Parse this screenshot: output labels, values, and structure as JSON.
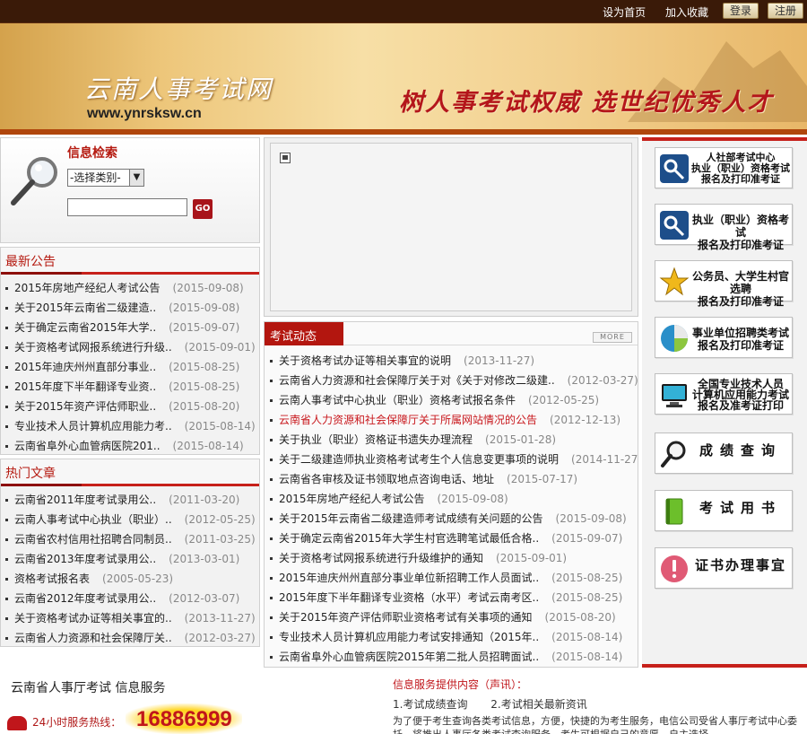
{
  "topbar": {
    "links": [
      "设为首页",
      "加入收藏"
    ],
    "login": "登录",
    "register": "注册"
  },
  "banner": {
    "site_name": "云南人事考试网",
    "site_url": "www.ynrsksw.cn",
    "slogan": "树人事考试权威  选世纪优秀人才"
  },
  "search": {
    "title": "信息检索",
    "category_selected": "-选择类别-",
    "go_label": "GO"
  },
  "announcements": {
    "title": "最新公告",
    "items": [
      {
        "text": "2015年房地产经纪人考试公告",
        "date": "(2015-09-08)"
      },
      {
        "text": "关于2015年云南省二级建造..",
        "date": "(2015-09-08)"
      },
      {
        "text": "关于确定云南省2015年大学..",
        "date": "(2015-09-07)"
      },
      {
        "text": "关于资格考试网报系统进行升级..",
        "date": "(2015-09-01)"
      },
      {
        "text": "2015年迪庆州州直部分事业..",
        "date": "(2015-08-25)"
      },
      {
        "text": "2015年度下半年翻译专业资..",
        "date": "(2015-08-25)"
      },
      {
        "text": "关于2015年资产评估师职业..",
        "date": "(2015-08-20)"
      },
      {
        "text": "专业技术人员计算机应用能力考..",
        "date": "(2015-08-14)"
      },
      {
        "text": "云南省阜外心血管病医院201..",
        "date": "(2015-08-14)"
      }
    ]
  },
  "hot_articles": {
    "title": "热门文章",
    "items": [
      {
        "text": "云南省2011年度考试录用公..",
        "date": "(2011-03-20)"
      },
      {
        "text": "云南人事考试中心执业（职业）..",
        "date": "(2012-05-25)"
      },
      {
        "text": "云南省农村信用社招聘合同制员..",
        "date": "(2011-03-25)"
      },
      {
        "text": "云南省2013年度考试录用公..",
        "date": "(2013-03-01)"
      },
      {
        "text": "资格考试报名表",
        "date": "(2005-05-23)"
      },
      {
        "text": "云南省2012年度考试录用公..",
        "date": "(2012-03-07)"
      },
      {
        "text": "关于资格考试办证等相关事宜的..",
        "date": "(2013-11-27)"
      },
      {
        "text": "云南省人力资源和社会保障厅关..",
        "date": "(2012-03-27)"
      }
    ]
  },
  "exam_news": {
    "title": "考试动态",
    "more": "MORE",
    "items": [
      {
        "text": "关于资格考试办证等相关事宜的说明",
        "date": "(2013-11-27)",
        "red": false
      },
      {
        "text": "云南省人力资源和社会保障厅关于对《关于对修改二级建..",
        "date": "(2012-03-27)",
        "red": false
      },
      {
        "text": "云南人事考试中心执业（职业）资格考试报名条件",
        "date": "(2012-05-25)",
        "red": false
      },
      {
        "text": "云南省人力资源和社会保障厅关于所属网站情况的公告",
        "date": "(2012-12-13)",
        "red": true
      },
      {
        "text": "关于执业（职业）资格证书遗失办理流程",
        "date": "(2015-01-28)",
        "red": false
      },
      {
        "text": "关于二级建造师执业资格考试考生个人信息变更事项的说明",
        "date": "(2014-11-27)",
        "red": false
      },
      {
        "text": "云南省各审核及证书领取地点咨询电话、地址",
        "date": "(2015-07-17)",
        "red": false
      },
      {
        "text": "2015年房地产经纪人考试公告",
        "date": "(2015-09-08)",
        "red": false
      },
      {
        "text": "关于2015年云南省二级建造师考试成绩有关问题的公告",
        "date": "(2015-09-08)",
        "red": false
      },
      {
        "text": "关于确定云南省2015年大学生村官选聘笔试最低合格..",
        "date": "(2015-09-07)",
        "red": false
      },
      {
        "text": "关于资格考试网报系统进行升级维护的通知",
        "date": "(2015-09-01)",
        "red": false
      },
      {
        "text": "2015年迪庆州州直部分事业单位新招聘工作人员面试..",
        "date": "(2015-08-25)",
        "red": false
      },
      {
        "text": "2015年度下半年翻译专业资格（水平）考试云南考区..",
        "date": "(2015-08-25)",
        "red": false
      },
      {
        "text": "关于2015年资产评估师职业资格考试有关事项的通知",
        "date": "(2015-08-20)",
        "red": false
      },
      {
        "text": "专业技术人员计算机应用能力考试安排通知（2015年..",
        "date": "(2015-08-14)",
        "red": false
      },
      {
        "text": "云南省阜外心血管病医院2015年第二批人员招聘面试..",
        "date": "(2015-08-14)",
        "red": false
      }
    ]
  },
  "right_buttons": [
    {
      "lines": [
        "人社部考试中心",
        "执业（职业）资格考试",
        "报名及打印准考证"
      ]
    },
    {
      "lines": [
        "执业（职业）资格考试",
        "报名及打印准考证"
      ]
    },
    {
      "lines": [
        "公务员、大学生村官选聘",
        "报名及打印准考证"
      ]
    },
    {
      "lines": [
        "事业单位招聘类考试",
        "报名及打印准考证"
      ]
    },
    {
      "lines": [
        "全国专业技术人员",
        "计算机应用能力考试",
        "报名及准考证打印"
      ]
    },
    {
      "lines": [
        "成绩查询"
      ]
    },
    {
      "lines": [
        "考试用书"
      ]
    },
    {
      "lines": [
        "证书办理事宜"
      ]
    }
  ],
  "footer": {
    "title": "云南省人事厅考试    信息服务",
    "hotline_label": "24小时服务热线：",
    "hotline_number": "16886999",
    "info_title": "信息服务提供内容（声讯）：",
    "info_links": [
      "1.考试成绩查询",
      "2.考试相关最新资讯"
    ],
    "info_desc": "为了便于考生查询各类考试信息，方便，快捷的为考生服务，电信公司受省人事厅考试中心委托，将推出人事厅各类考试查询服务，考生可根据自己的意愿，自主选择"
  },
  "colors": {
    "accent": "#c6201a",
    "dark": "#3a1a08",
    "link_red": "#c8171c"
  }
}
